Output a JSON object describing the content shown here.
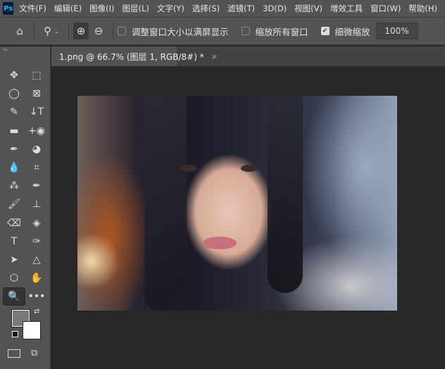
{
  "menubar": {
    "logo": "Ps",
    "items": [
      "文件(F)",
      "编辑(E)",
      "图像(I)",
      "图层(L)",
      "文字(Y)",
      "选择(S)",
      "滤镜(T)",
      "3D(D)",
      "视图(V)",
      "增效工具",
      "窗口(W)",
      "帮助(H)"
    ]
  },
  "options": {
    "fit_screen": {
      "label": "调整窗口大小以满屏显示",
      "checked": false
    },
    "zoom_all": {
      "label": "缩放所有窗口",
      "checked": false
    },
    "scrubby": {
      "label": "细微缩放",
      "checked": true
    },
    "zoom_value": "100%"
  },
  "document": {
    "tab_title": "1.png @ 66.7% (图层 1, RGB/8#) *",
    "close": "×"
  },
  "toolbar": {
    "collapse": "‹‹",
    "tools": [
      {
        "name": "move-tool",
        "glyph": "✥"
      },
      {
        "name": "marquee-tool",
        "glyph": "⬚"
      },
      {
        "name": "lasso-tool",
        "glyph": "◯"
      },
      {
        "name": "frame-tool",
        "glyph": "⊠"
      },
      {
        "name": "quick-selection-tool",
        "glyph": "✎"
      },
      {
        "name": "vertical-type-mask-tool",
        "glyph": "↓T"
      },
      {
        "name": "gradient-tool",
        "glyph": "▬"
      },
      {
        "name": "red-eye-tool",
        "glyph": "+◉"
      },
      {
        "name": "eyedropper-tool",
        "glyph": "✒"
      },
      {
        "name": "patch-tool",
        "glyph": "◕"
      },
      {
        "name": "blur-tool",
        "glyph": "💧"
      },
      {
        "name": "crop-tool",
        "glyph": "⌗"
      },
      {
        "name": "magic-wand-tool",
        "glyph": "⁂"
      },
      {
        "name": "color-sampler-tool",
        "glyph": "✒"
      },
      {
        "name": "brush-tool",
        "glyph": "🖌"
      },
      {
        "name": "stamp-tool",
        "glyph": "⊥"
      },
      {
        "name": "eraser-tool",
        "glyph": "⌫"
      },
      {
        "name": "paint-bucket-tool",
        "glyph": "◈"
      },
      {
        "name": "type-tool",
        "glyph": "T"
      },
      {
        "name": "pen-tool",
        "glyph": "✑"
      },
      {
        "name": "path-selection-tool",
        "glyph": "➤"
      },
      {
        "name": "triangle-tool",
        "glyph": "△"
      },
      {
        "name": "polygon-tool",
        "glyph": "⬡"
      },
      {
        "name": "hand-tool",
        "glyph": "✋"
      },
      {
        "name": "zoom-tool",
        "glyph": "🔍"
      },
      {
        "name": "more-tools",
        "glyph": "•••"
      }
    ],
    "foreground": "#7a7a7a",
    "background": "#ffffff"
  }
}
